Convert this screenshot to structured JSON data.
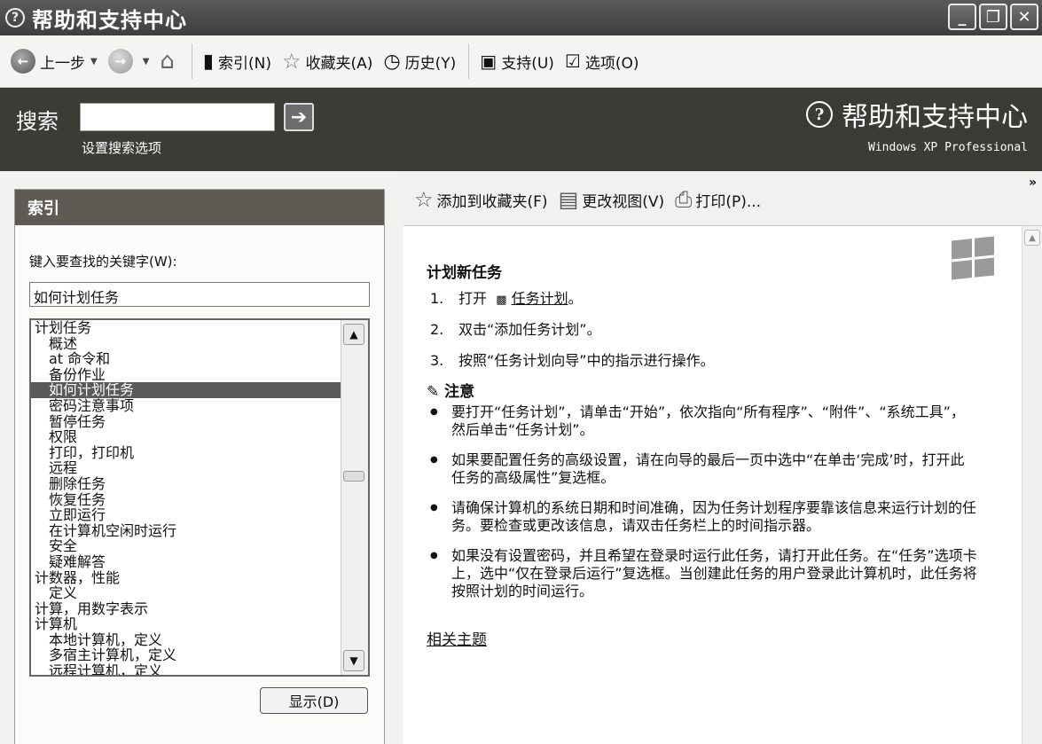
{
  "window": {
    "title": "帮助和支持中心"
  },
  "toolbar": {
    "back": "上一步",
    "index": "索引(N)",
    "favorites": "收藏夹(A)",
    "history": "历史(Y)",
    "support": "支持(U)",
    "options": "选项(O)"
  },
  "search": {
    "label": "搜索",
    "value": "",
    "options_link": "设置搜索选项",
    "brand_title": "帮助和支持中心",
    "brand_sub": "Windows XP Professional"
  },
  "index_panel": {
    "header": "索引",
    "prompt": "键入要查找的关键字(W):",
    "keyword": "如何计划任务",
    "items": [
      {
        "label": "计划任务",
        "sub": false,
        "selected": false
      },
      {
        "label": "概述",
        "sub": true,
        "selected": false
      },
      {
        "label": "at 命令和",
        "sub": true,
        "selected": false
      },
      {
        "label": "备份作业",
        "sub": true,
        "selected": false
      },
      {
        "label": "如何计划任务",
        "sub": true,
        "selected": true
      },
      {
        "label": "密码注意事项",
        "sub": true,
        "selected": false
      },
      {
        "label": "暂停任务",
        "sub": true,
        "selected": false
      },
      {
        "label": "权限",
        "sub": true,
        "selected": false
      },
      {
        "label": "打印，打印机",
        "sub": true,
        "selected": false
      },
      {
        "label": "远程",
        "sub": true,
        "selected": false
      },
      {
        "label": "删除任务",
        "sub": true,
        "selected": false
      },
      {
        "label": "恢复任务",
        "sub": true,
        "selected": false
      },
      {
        "label": "立即运行",
        "sub": true,
        "selected": false
      },
      {
        "label": "在计算机空闲时运行",
        "sub": true,
        "selected": false
      },
      {
        "label": "安全",
        "sub": true,
        "selected": false
      },
      {
        "label": "疑难解答",
        "sub": true,
        "selected": false
      },
      {
        "label": "计数器，性能",
        "sub": false,
        "selected": false
      },
      {
        "label": "定义",
        "sub": true,
        "selected": false
      },
      {
        "label": "计算，用数字表示",
        "sub": false,
        "selected": false
      },
      {
        "label": "计算机",
        "sub": false,
        "selected": false
      },
      {
        "label": "本地计算机，定义",
        "sub": true,
        "selected": false
      },
      {
        "label": "多宿主计算机，定义",
        "sub": true,
        "selected": false
      },
      {
        "label": "远程计算机，定义",
        "sub": true,
        "selected": false
      }
    ],
    "show_button": "显示(D)"
  },
  "content_toolbar": {
    "add_favorites": "添加到收藏夹(F)",
    "change_view": "更改视图(V)",
    "print": "打印(P)..."
  },
  "article": {
    "title": "计划新任务",
    "steps": [
      {
        "num": "1.",
        "pre": "打开",
        "link": "任务计划",
        "post": "。"
      },
      {
        "num": "2.",
        "text": "双击“添加任务计划”。"
      },
      {
        "num": "3.",
        "text": "按照“任务计划向导”中的指示进行操作。"
      }
    ],
    "note_title": "注意",
    "notes": [
      "要打开“任务计划”，请单击“开始”，依次指向“所有程序”、“附件”、“系统工具”，然后单击“任务计划”。",
      "如果要配置任务的高级设置，请在向导的最后一页中选中“在单击‘完成’时，打开此任务的高级属性”复选框。",
      "请确保计算机的系统日期和时间准确，因为任务计划程序要靠该信息来运行计划的任务。要检查或更改该信息，请双击任务栏上的时间指示器。",
      "如果没有设置密码，并且希望在登录时运行此任务，请打开此任务。在“任务”选项卡上，选中“仅在登录后运行”复选框。当创建此任务的用户登录此计算机时，此任务将按照计划的时间运行。"
    ],
    "related": "相关主题"
  }
}
